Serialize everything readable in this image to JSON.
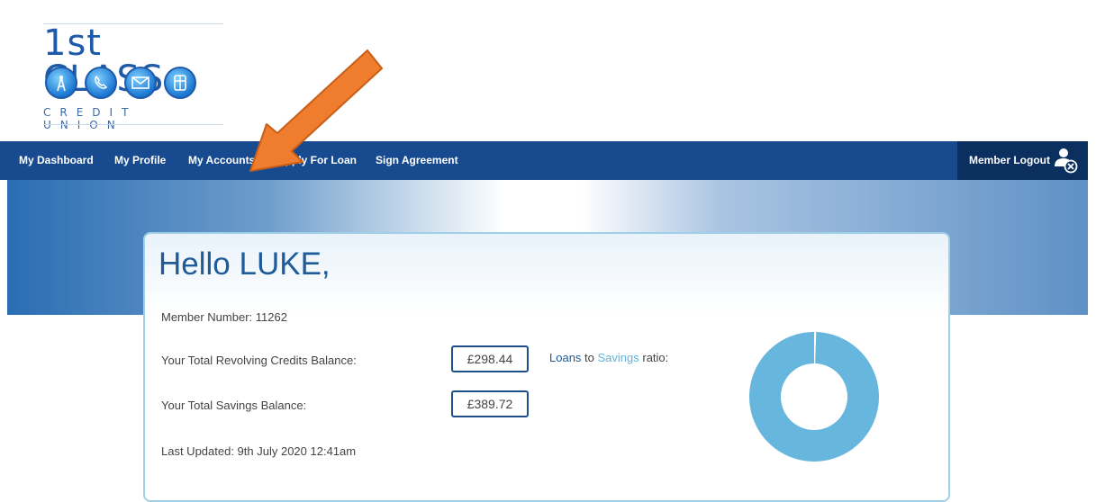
{
  "logo": {
    "title": "1st CLASS",
    "subtitle": "CREDIT UNION",
    "icons": [
      "antenna-icon",
      "phone-icon",
      "mail-icon",
      "atm-card-icon"
    ]
  },
  "nav": {
    "items": [
      {
        "label": "My Dashboard"
      },
      {
        "label": "My Profile"
      },
      {
        "label": "My Accounts"
      },
      {
        "label": "Apply For Loan"
      },
      {
        "label": "Sign Agreement"
      }
    ],
    "logout_label": "Member Logout"
  },
  "card": {
    "greeting": "Hello LUKE,",
    "member_number": "Member Number: 11262",
    "revolving_label": "Your Total Revolving Credits Balance:",
    "revolving_value": "£298.44",
    "savings_label": "Your Total Savings Balance:",
    "savings_value": "£389.72",
    "last_updated": "Last Updated: 9th July 2020 12:41am",
    "ratio": {
      "loans_word": "Loans",
      "to_word": " to ",
      "savings_word": "Savings",
      "ratio_word": " ratio:"
    }
  },
  "chart_data": {
    "type": "pie",
    "categories": [
      "Loans",
      "Savings"
    ],
    "values": [
      0.5,
      99.5
    ],
    "colors": [
      "#ffffff",
      "#67b6dd"
    ]
  },
  "colors": {
    "nav_bg": "#174a8f",
    "logout_bg": "#0b2f5e",
    "brand_blue": "#1d5b9a",
    "donut": "#67b6dd",
    "arrow": "#ef7d2d"
  }
}
